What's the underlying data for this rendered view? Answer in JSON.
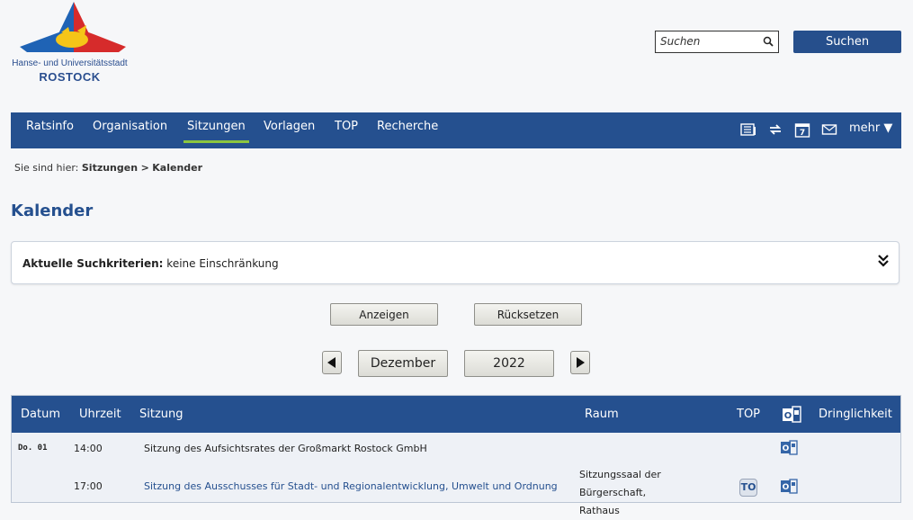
{
  "logo": {
    "line1": "Hanse- und Universitätsstadt",
    "line2": "ROSTOCK"
  },
  "search": {
    "placeholder": "Suchen",
    "button": "Suchen"
  },
  "nav": {
    "items": [
      "Ratsinfo",
      "Organisation",
      "Sitzungen",
      "Vorlagen",
      "TOP",
      "Recherche"
    ],
    "active": "Sitzungen",
    "more": "mehr ▼",
    "calendar_day": "7"
  },
  "breadcrumb": {
    "prefix": "Sie sind hier:",
    "path1": "Sitzungen",
    "sep": ">",
    "path2": "Kalender"
  },
  "page": {
    "title": "Kalender"
  },
  "criteria": {
    "label": "Aktuelle Suchkriterien:",
    "value": "keine Einschränkung"
  },
  "buttons": {
    "show": "Anzeigen",
    "reset": "Rücksetzen"
  },
  "period": {
    "month": "Dezember",
    "year": "2022"
  },
  "table": {
    "headers": {
      "date": "Datum",
      "time": "Uhrzeit",
      "meeting": "Sitzung",
      "room": "Raum",
      "top": "TOP",
      "urgency": "Dringlichkeit"
    },
    "rows": [
      {
        "date": "Do. 01",
        "time": "14:00",
        "meeting": "Sitzung des Aufsichtsrates der Großmarkt Rostock GmbH",
        "room": "",
        "top": ""
      },
      {
        "date": "",
        "time": "17:00",
        "meeting": "Sitzung des Ausschusses für Stadt- und Regionalentwicklung, Umwelt und Ordnung",
        "room": "Sitzungssaal der Bürgerschaft, Rathaus",
        "top": "TO"
      }
    ]
  },
  "colors": {
    "primary": "#25508f",
    "accent": "#8cc63f",
    "background": "#f6f7f9"
  }
}
